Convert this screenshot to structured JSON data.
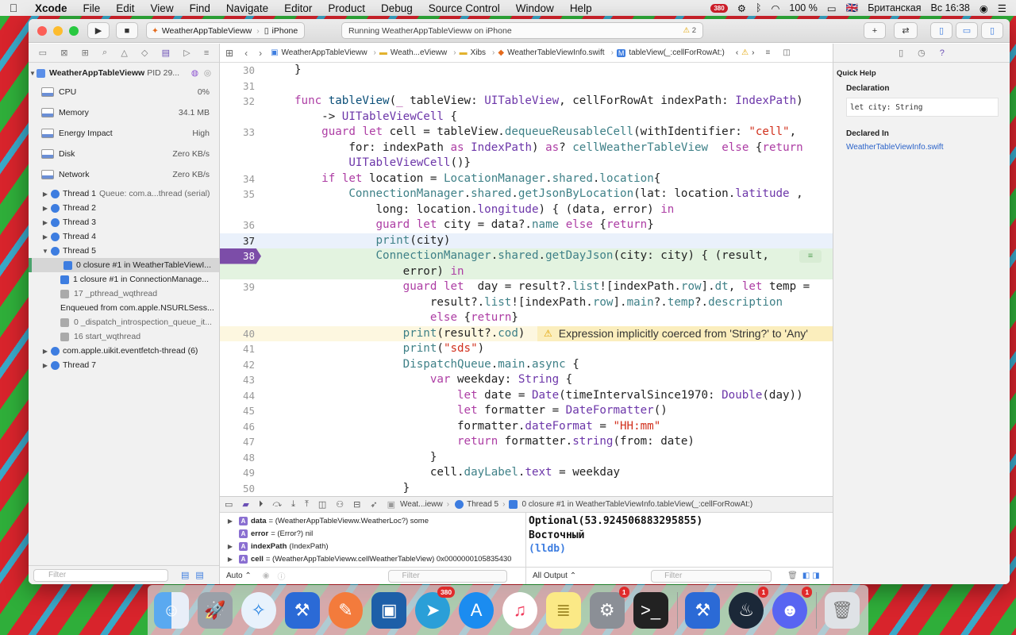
{
  "menubar": {
    "app": "Xcode",
    "items": [
      "File",
      "Edit",
      "View",
      "Find",
      "Navigate",
      "Editor",
      "Product",
      "Debug",
      "Source Control",
      "Window",
      "Help"
    ],
    "badge": "380",
    "battery": "100 %",
    "input_source": "Британская",
    "clock": "Вс 16:38"
  },
  "toolbar": {
    "scheme": "WeatherAppTableVieww",
    "device": "iPhone",
    "status": "Running WeatherAppTableVieww on iPhone",
    "warnings": "2"
  },
  "navigator": {
    "process": "WeatherAppTableVieww",
    "pid": "PID 29...",
    "gauges": [
      {
        "label": "CPU",
        "value": "0%"
      },
      {
        "label": "Memory",
        "value": "34.1 MB"
      },
      {
        "label": "Energy Impact",
        "value": "High"
      },
      {
        "label": "Disk",
        "value": "Zero KB/s"
      },
      {
        "label": "Network",
        "value": "Zero KB/s"
      }
    ],
    "threads": {
      "t1": "Thread 1",
      "t1q": "Queue: com.a...thread (serial)",
      "t2": "Thread 2",
      "t3": "Thread 3",
      "t4": "Thread 4",
      "t5": "Thread 5",
      "f0": "0 closure #1 in WeatherTableViewI...",
      "f1": "1 closure #1 in ConnectionManage...",
      "f17": "17 _pthread_wqthread",
      "enq": "Enqueued from com.apple.NSURLSess...",
      "f0b": "0 _dispatch_introspection_queue_it...",
      "f16": "16 start_wqthread",
      "uikit": "com.apple.uikit.eventfetch-thread (6)",
      "t7": "Thread 7"
    },
    "filter_placeholder": "Filter"
  },
  "jumpbar": {
    "c1": "WeatherAppTableVieww",
    "c2": "Weath...eVieww",
    "c3": "Xibs",
    "c4": "WeatherTableViewInfo.swift",
    "c5": "tableView(_:cellForRowAt:)"
  },
  "code": {
    "ln": [
      "30",
      "31",
      "32",
      "",
      "33",
      "",
      "",
      "34",
      "35",
      "",
      "36",
      "37",
      "38",
      "",
      "39",
      "",
      "",
      "40",
      "41",
      "42",
      "43",
      "44",
      "45",
      "46",
      "47",
      "48",
      "49",
      "50"
    ],
    "warning": "Expression implicitly coerced from 'String?' to 'Any'"
  },
  "debugbar": {
    "c1": "Weat...ieww",
    "c2": "Thread 5",
    "c3": "0 closure #1 in WeatherTableViewInfo.tableView(_:cellForRowAt:)"
  },
  "variables": [
    {
      "name": "data",
      "detail": "= (WeatherAppTableVieww.WeatherLoc?) some"
    },
    {
      "name": "error",
      "detail": "= (Error?) nil"
    },
    {
      "name": "indexPath",
      "detail": "(IndexPath)"
    },
    {
      "name": "cell",
      "detail": "= (WeatherAppTableVieww.cellWeatherTableView) 0x0000000105835430"
    }
  ],
  "variables_footer": {
    "mode": "Auto",
    "filter": "Filter"
  },
  "console": {
    "lines": [
      "Optional(53.924506883295855)",
      "Восточный"
    ],
    "prompt": "(lldb)",
    "output_mode": "All Output",
    "filter": "Filter"
  },
  "inspector": {
    "title": "Quick Help",
    "declaration_label": "Declaration",
    "declaration": "let city: String",
    "declared_in_label": "Declared In",
    "declared_in": "WeatherTableViewInfo.swift"
  },
  "dock": {
    "badges": {
      "telegram": "380",
      "syspref": "1",
      "steam": "1",
      "discord": "1"
    }
  }
}
